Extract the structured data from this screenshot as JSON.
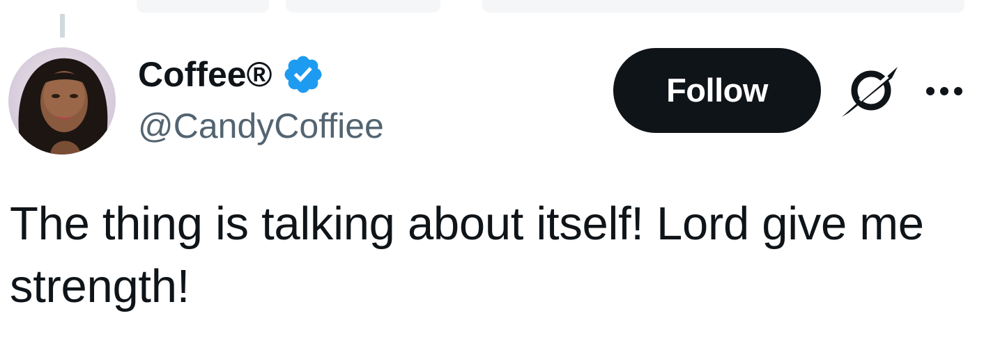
{
  "author": {
    "display_name": "Coffee®",
    "handle": "@CandyCoffiee",
    "verified": true,
    "avatar": "profile-photo"
  },
  "actions": {
    "follow_label": "Follow",
    "grok_icon": "grok-icon",
    "more_icon": "more-options-icon"
  },
  "tweet": {
    "text": "The thing is talking about itself! Lord give me strength!"
  },
  "colors": {
    "verified_blue": "#1d9bf0",
    "text_primary": "#0f1419",
    "text_secondary": "#536471",
    "button_bg": "#0f1419",
    "thread_line": "#cfd9de"
  }
}
